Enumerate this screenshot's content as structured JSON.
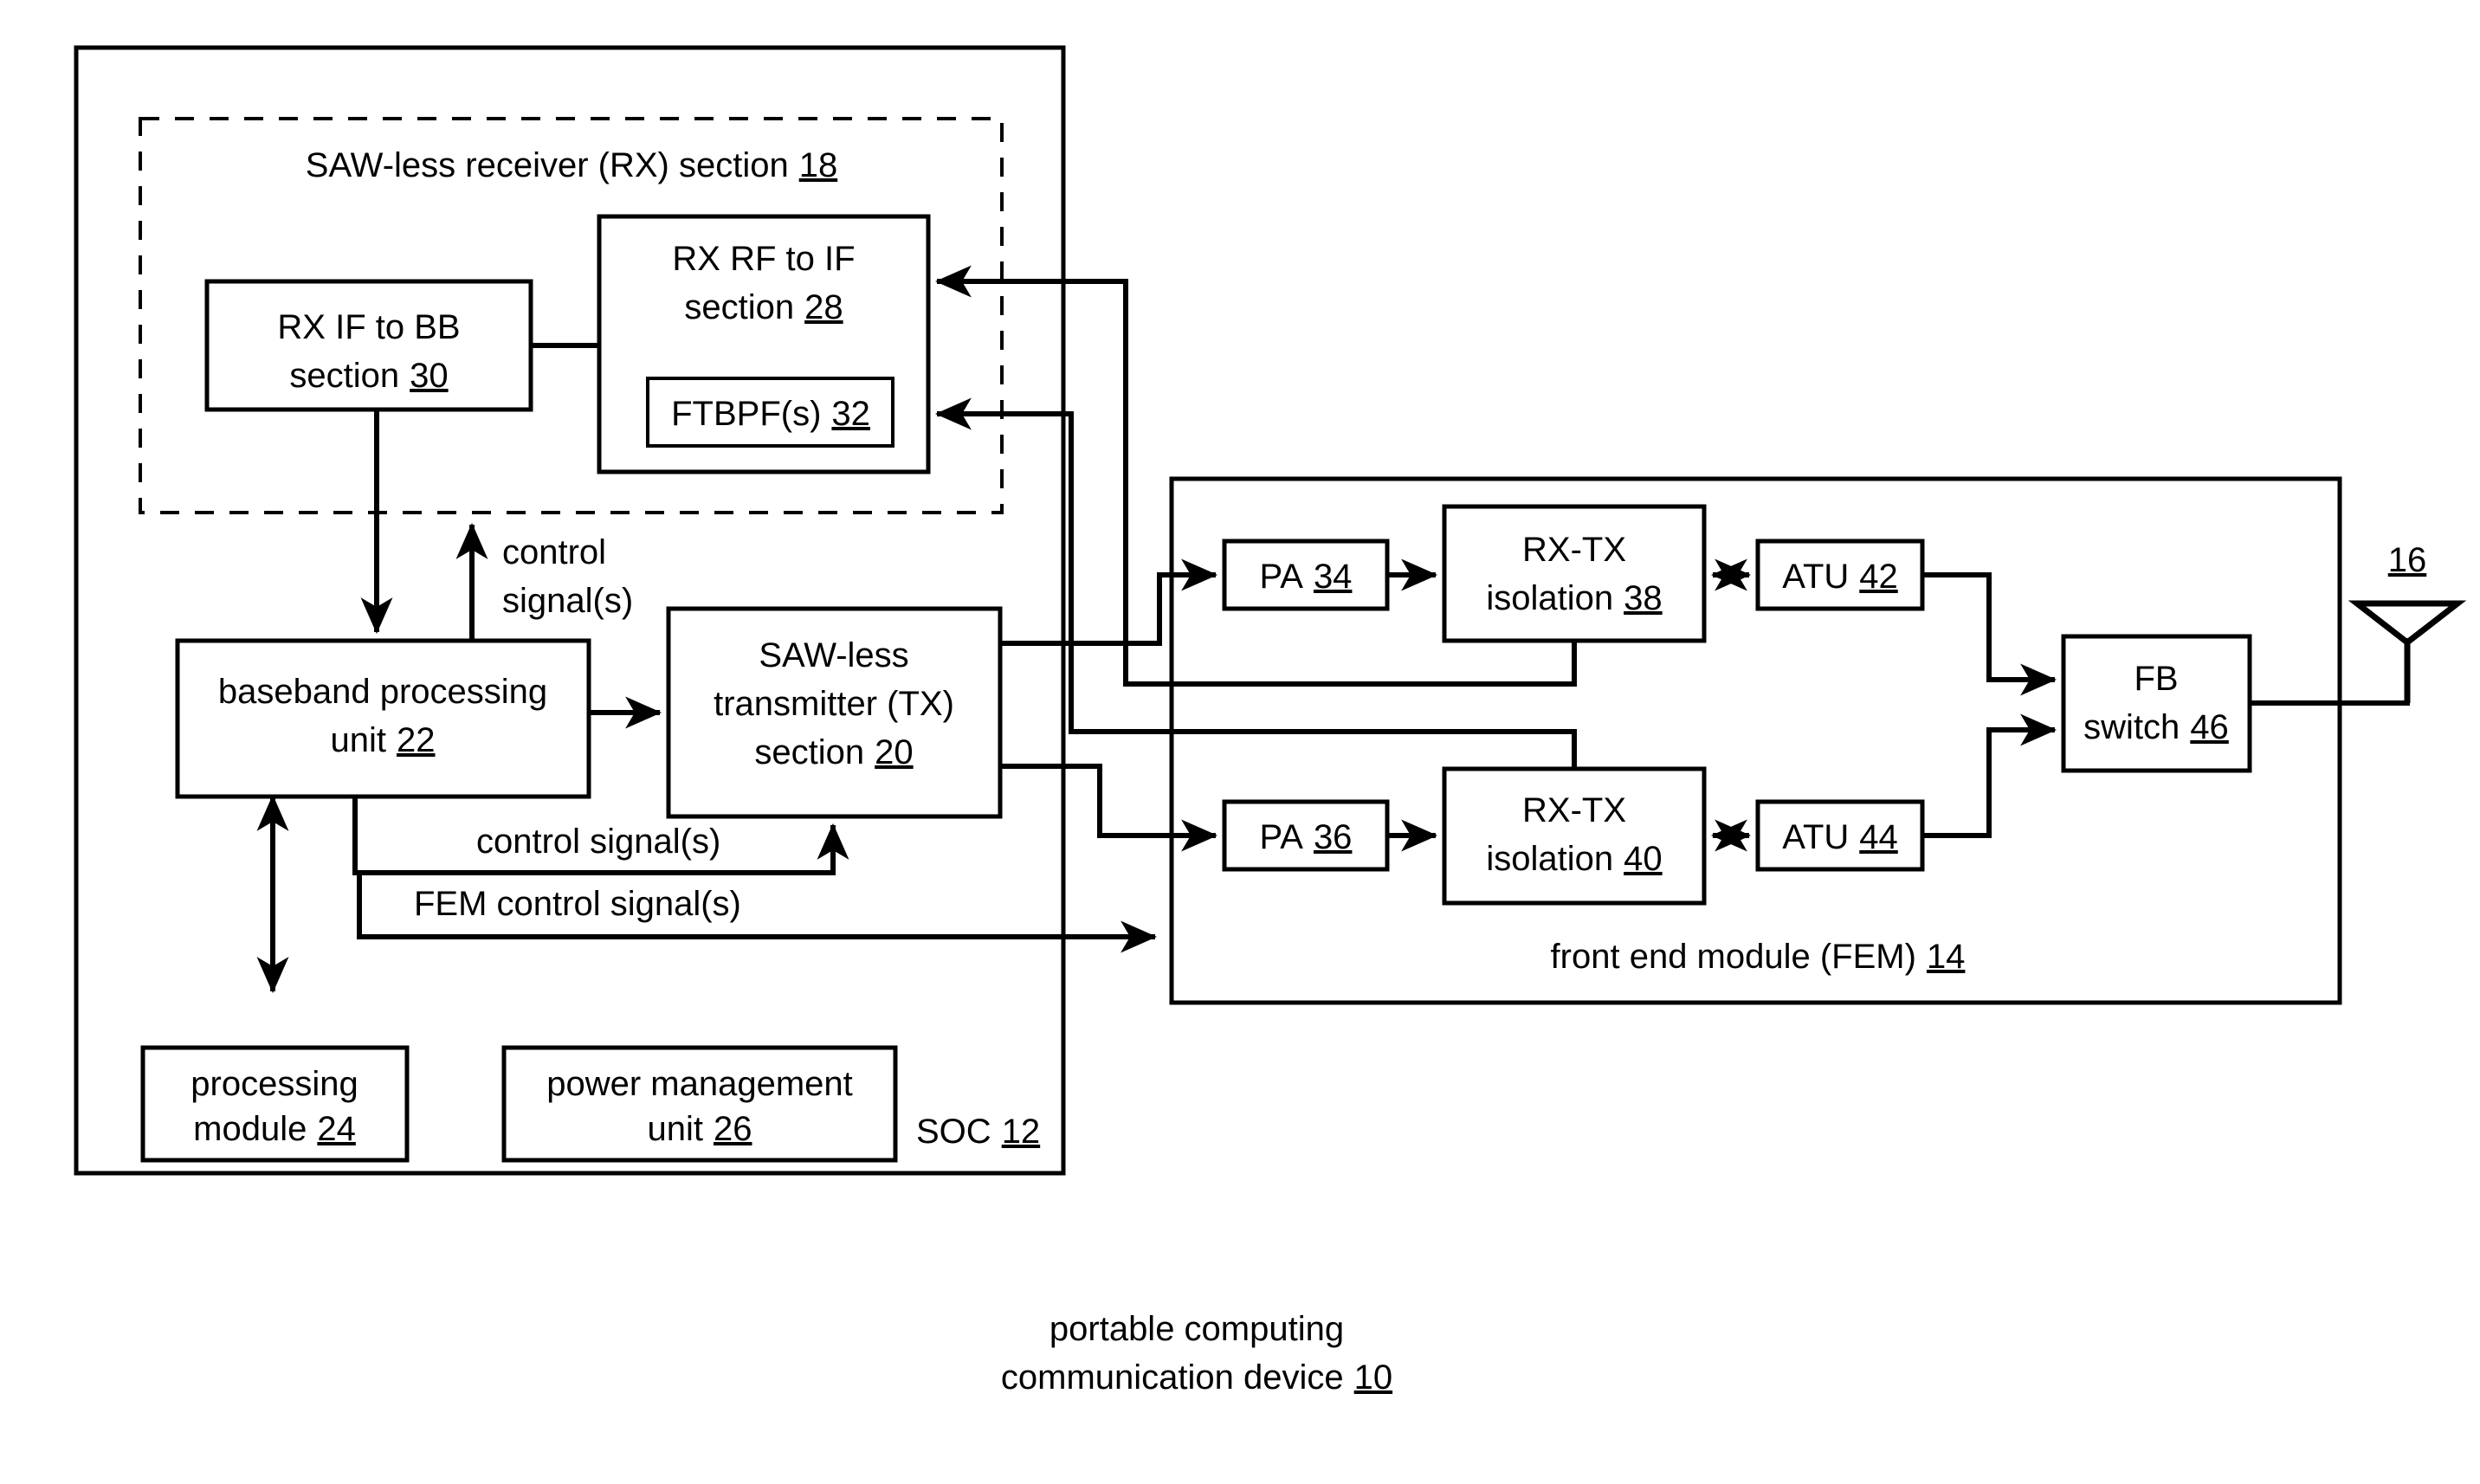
{
  "figure": {
    "caption_line1": "portable computing",
    "caption_line2": "communication device",
    "caption_ref": "10"
  },
  "soc": {
    "label": "SOC",
    "ref": "12"
  },
  "rx_section": {
    "label": "SAW-less receiver (RX) section",
    "ref": "18"
  },
  "blocks": {
    "rx_if_to_bb": {
      "line1": "RX IF to BB",
      "line2": "section",
      "ref": "30"
    },
    "rx_rf_to_if": {
      "line1": "RX RF to IF",
      "line2": "section",
      "ref": "28"
    },
    "ftbpf": {
      "line1": "FTBPF(s)",
      "ref": "32"
    },
    "baseband": {
      "line1": "baseband processing",
      "line2": "unit",
      "ref": "22"
    },
    "tx_section": {
      "line1": "SAW-less",
      "line2": "transmitter (TX)",
      "line3": "section",
      "ref": "20"
    },
    "processing_module": {
      "line1": "processing",
      "line2": "module",
      "ref": "24"
    },
    "power_management": {
      "line1": "power management",
      "line2": "unit",
      "ref": "26"
    },
    "pa_34": {
      "line1": "PA",
      "ref": "34"
    },
    "pa_36": {
      "line1": "PA",
      "ref": "36"
    },
    "isolation_38": {
      "line1": "RX-TX",
      "line2": "isolation",
      "ref": "38"
    },
    "isolation_40": {
      "line1": "RX-TX",
      "line2": "isolation",
      "ref": "40"
    },
    "atu_42": {
      "line1": "ATU",
      "ref": "42"
    },
    "atu_44": {
      "line1": "ATU",
      "ref": "44"
    },
    "fb_switch": {
      "line1": "FB",
      "line2": "switch",
      "ref": "46"
    }
  },
  "fem": {
    "label": "front end module (FEM)",
    "ref": "14"
  },
  "antenna": {
    "ref": "16",
    "icon": "antenna-icon"
  },
  "wire_labels": {
    "control_signals_rx_line1": "control",
    "control_signals_rx_line2": "signal(s)",
    "control_signals_tx": "control signal(s)",
    "fem_control_signals": "FEM control signal(s)"
  },
  "colors": {
    "ink": "#000000",
    "paper": "#ffffff"
  }
}
